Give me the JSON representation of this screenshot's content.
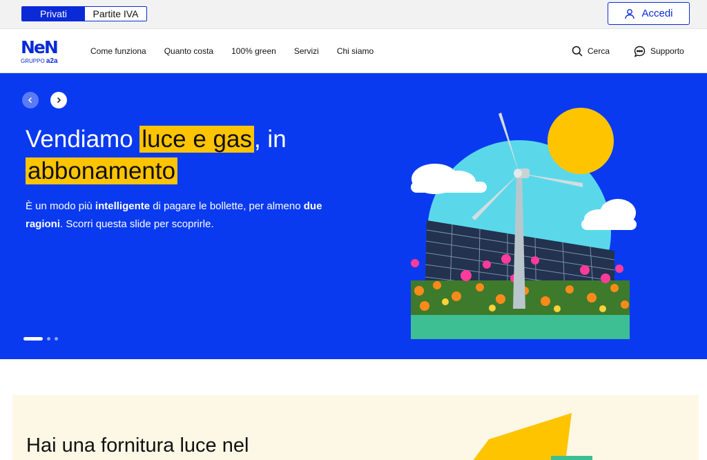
{
  "topbar": {
    "segments": [
      "Privati",
      "Partite IVA"
    ],
    "login_label": "Accedi"
  },
  "brand": {
    "wordmark": "NeN",
    "group_prefix": "GRUPPO",
    "group_name": "a2a",
    "color": "#0a2ad8"
  },
  "nav": {
    "items": [
      "Come funziona",
      "Quanto costa",
      "100% green",
      "Servizi",
      "Chi siamo"
    ],
    "search_label": "Cerca",
    "support_label": "Supporto"
  },
  "hero": {
    "background": "#0a3af0",
    "title_before": "Vendiamo ",
    "title_highlight_1": "luce e gas",
    "title_middle": ", in",
    "title_highlight_2": "abbonamento",
    "body_1": "È un modo più ",
    "body_bold_1": "intelligente",
    "body_2": " di pagare le bollette, per almeno ",
    "body_bold_2": "due ragioni",
    "body_3": ". Scorri questa slide per scoprirle.",
    "slides_total": 3,
    "slide_active": 1,
    "highlight_color": "#ffc400"
  },
  "teaser": {
    "title": "Hai una fornitura luce nel"
  }
}
